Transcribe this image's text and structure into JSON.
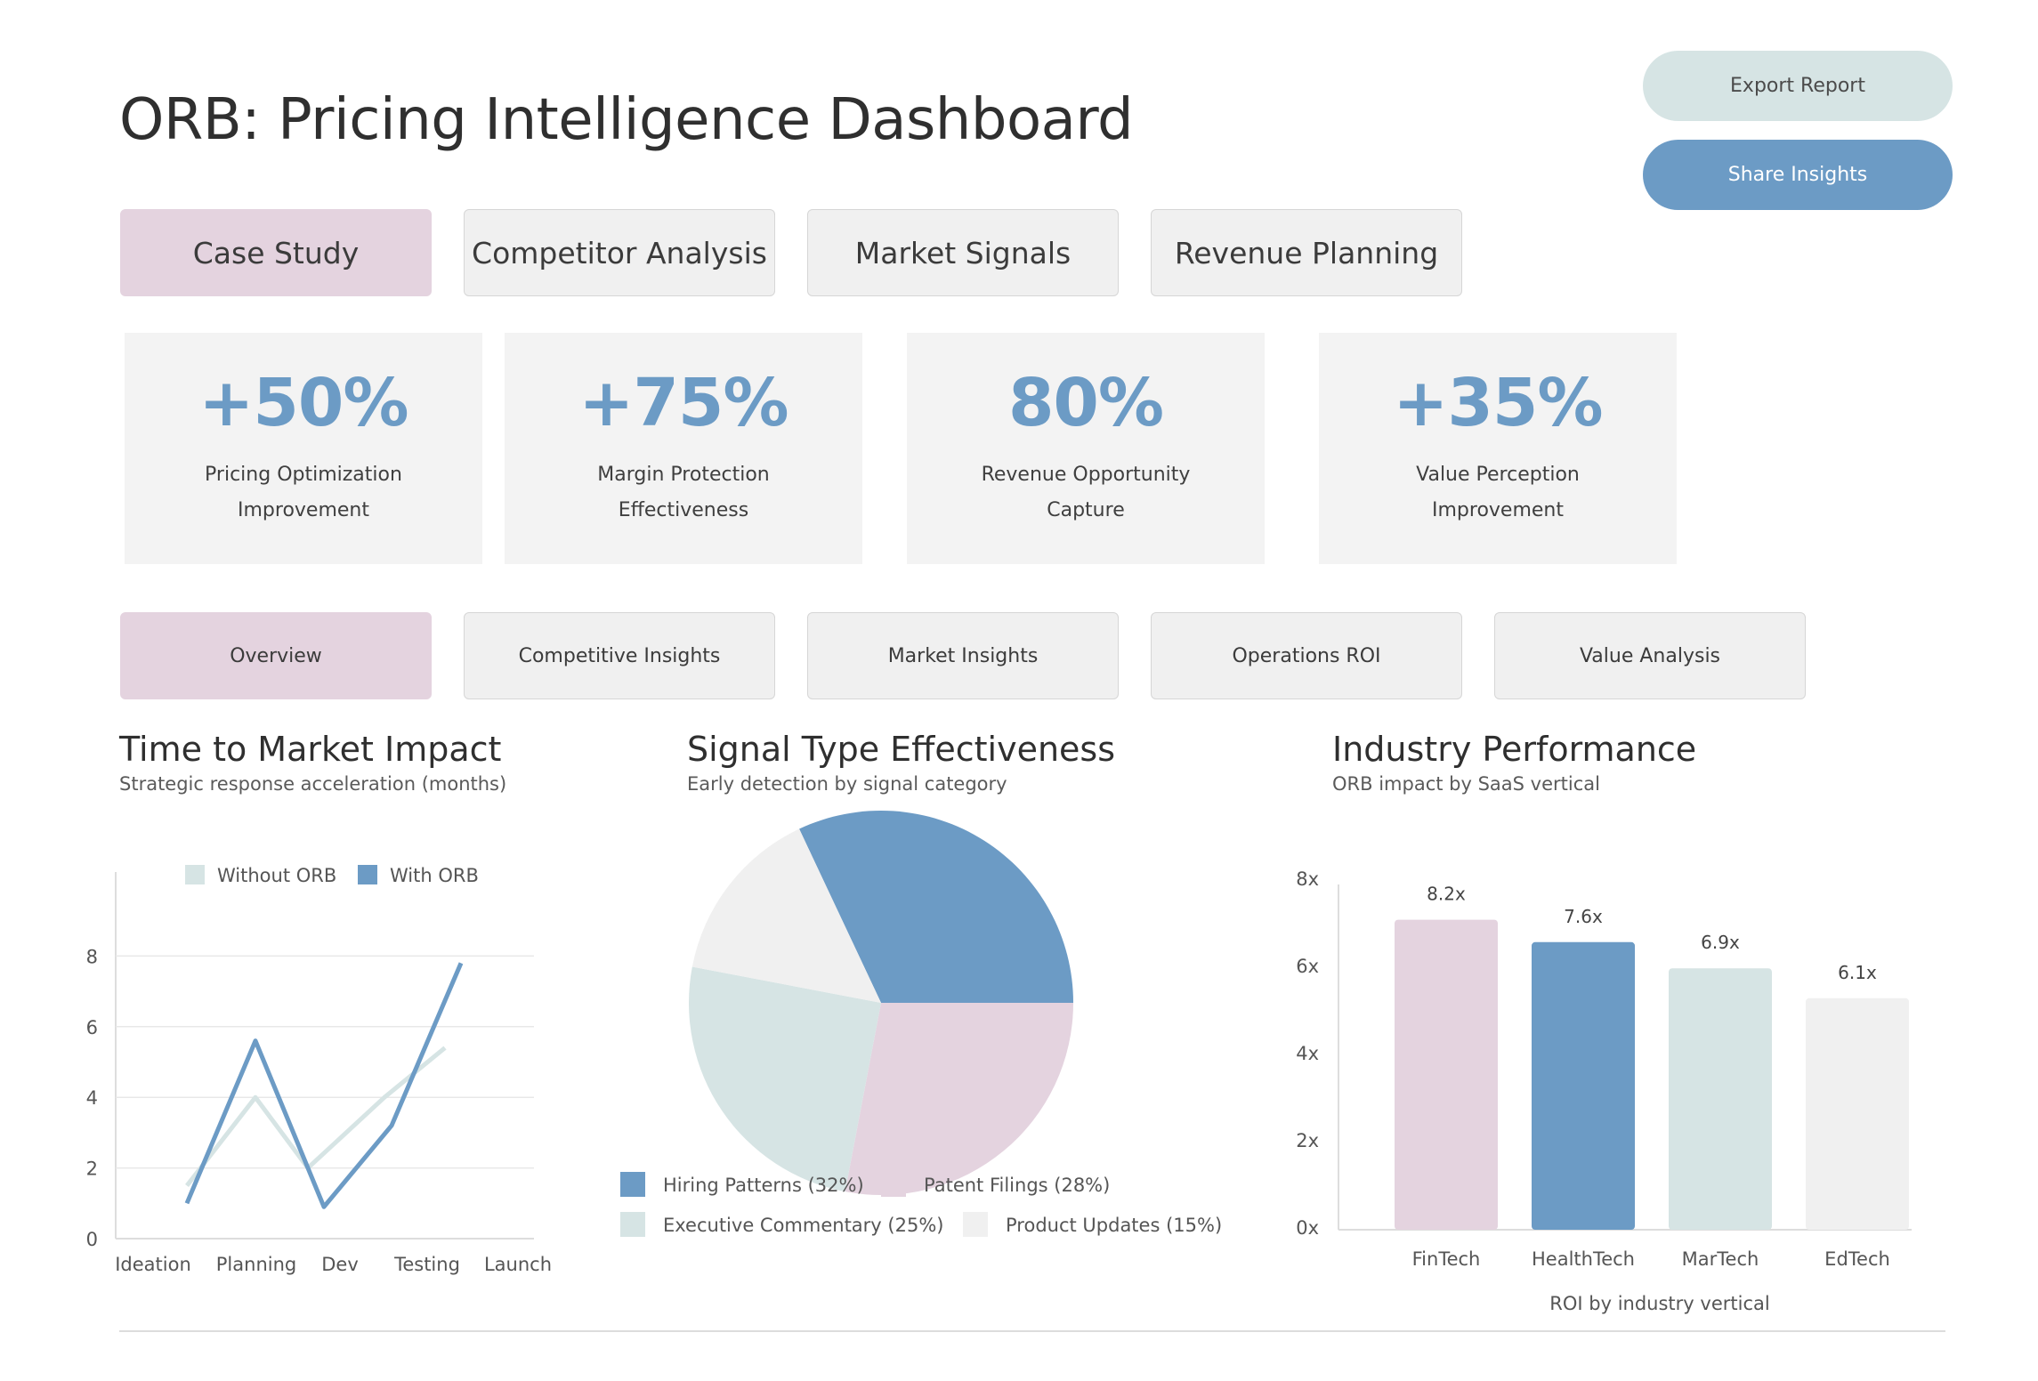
{
  "header": {
    "title": "ORB: Pricing Intelligence Dashboard",
    "export_label": "Export Report",
    "share_label": "Share Insights"
  },
  "main_tabs": [
    {
      "label": "Case Study",
      "active": true
    },
    {
      "label": "Competitor Analysis",
      "active": false
    },
    {
      "label": "Market Signals",
      "active": false
    },
    {
      "label": "Revenue Planning",
      "active": false
    }
  ],
  "metrics": [
    {
      "value": "+50%",
      "label": "Pricing Optimization Improvement"
    },
    {
      "value": "+75%",
      "label": "Margin Protection Effectiveness"
    },
    {
      "value": "80%",
      "label": "Revenue Opportunity Capture"
    },
    {
      "value": "+35%",
      "label": "Value Perception Improvement"
    }
  ],
  "sub_tabs": [
    {
      "label": "Overview",
      "active": true
    },
    {
      "label": "Competitive Insights",
      "active": false
    },
    {
      "label": "Market Insights",
      "active": false
    },
    {
      "label": "Operations ROI",
      "active": false
    },
    {
      "label": "Value Analysis",
      "active": false
    }
  ],
  "colors": {
    "accent_blue": "#6c9bc5",
    "pink": "#e4d3df",
    "teal_light": "#d6e4e4",
    "grey_light": "#f0f0f0"
  },
  "chart_data": [
    {
      "type": "line",
      "title": "Time to Market Impact",
      "subtitle": "Strategic response acceleration (months)",
      "categories": [
        "Ideation",
        "Planning",
        "Dev",
        "Testing",
        "Launch"
      ],
      "ylim": [
        0,
        10
      ],
      "yticks": [
        0,
        2,
        4,
        6,
        8
      ],
      "grid": true,
      "legend": "top",
      "series": [
        {
          "name": "Without ORB",
          "color": "#d6e4e4",
          "values": [
            1.5,
            4.0,
            2.0,
            4.0,
            5.4
          ]
        },
        {
          "name": "With ORB",
          "color": "#6c9bc5",
          "values": [
            1.0,
            5.6,
            0.9,
            3.2,
            7.8
          ]
        }
      ]
    },
    {
      "type": "pie",
      "title": "Signal Type Effectiveness",
      "subtitle": "Early detection by signal category",
      "legend": "bottom",
      "slices": [
        {
          "name": "Hiring Patterns (32%)",
          "value": 32,
          "color": "#6c9bc5"
        },
        {
          "name": "Patent Filings (28%)",
          "value": 28,
          "color": "#e4d3df"
        },
        {
          "name": "Executive Commentary (25%)",
          "value": 25,
          "color": "#d6e4e4"
        },
        {
          "name": "Product Updates (15%)",
          "value": 15,
          "color": "#f0f0f0"
        }
      ]
    },
    {
      "type": "bar",
      "title": "Industry Performance",
      "subtitle": "ORB impact by SaaS vertical",
      "xlabel": "ROI by industry vertical",
      "categories": [
        "FinTech",
        "HealthTech",
        "MarTech",
        "EdTech"
      ],
      "values": [
        8.2,
        7.6,
        6.9,
        6.1
      ],
      "value_labels": [
        "8.2x",
        "7.6x",
        "6.9x",
        "6.1x"
      ],
      "colors": [
        "#e4d3df",
        "#6c9bc5",
        "#d6e4e4",
        "#f0f0f0"
      ],
      "ylim": [
        0,
        8
      ],
      "yticks": [
        "0x",
        "2x",
        "4x",
        "6x",
        "8x"
      ],
      "grid": false
    }
  ]
}
